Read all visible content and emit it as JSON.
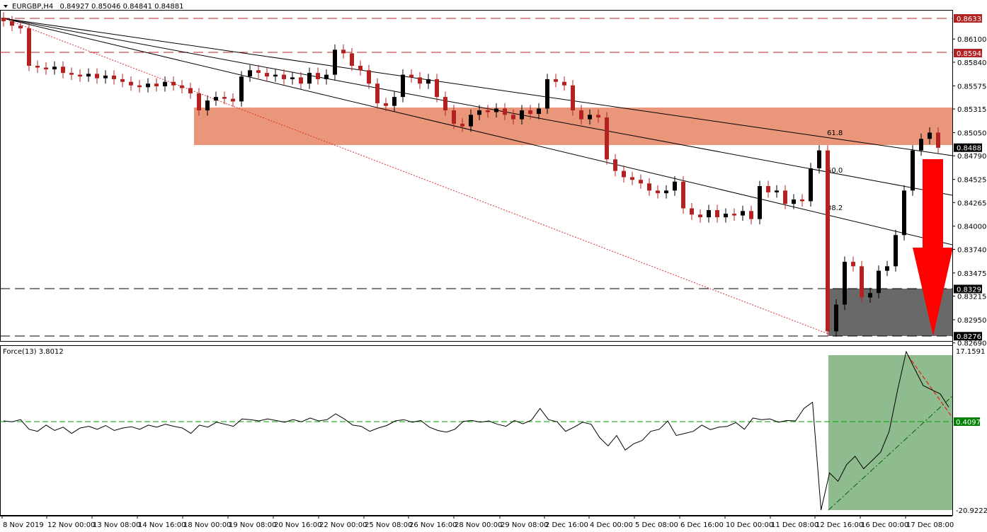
{
  "header": {
    "symbol": "EURGBP,H4",
    "open": "0.84927",
    "high": "0.85046",
    "low": "0.84841",
    "close": "0.84881"
  },
  "indicator": {
    "label": "Force(13) 3.8012",
    "max_label": "17.1591",
    "min_label": "-20.9222",
    "level_label": "0.4097"
  },
  "fib_labels": {
    "f618": "61.8",
    "f500": "50.0",
    "f382": "38.2"
  },
  "price_badges": [
    {
      "text": "0.86332",
      "price": 0.86332,
      "color": "#b22222"
    },
    {
      "text": "0.85943",
      "price": 0.85943,
      "color": "#b22222"
    },
    {
      "text": "0.84881",
      "price": 0.84881,
      "color": "#000000"
    },
    {
      "text": "0.83295",
      "price": 0.83295,
      "color": "#000000"
    },
    {
      "text": "0.82765",
      "price": 0.82765,
      "color": "#000000"
    }
  ],
  "price_ticks": [
    "0.86100",
    "0.85840",
    "0.85575",
    "0.85315",
    "0.85050",
    "0.84790",
    "0.84525",
    "0.84265",
    "0.84000",
    "0.83740",
    "0.83475",
    "0.83215",
    "0.82950",
    "0.82690"
  ],
  "time_labels": [
    "8 Nov 2019",
    "12 Nov 00:00",
    "13 Nov 08:00",
    "14 Nov 16:00",
    "18 Nov 00:00",
    "19 Nov 08:00",
    "20 Nov 16:00",
    "22 Nov 00:00",
    "25 Nov 08:00",
    "26 Nov 16:00",
    "28 Nov 00:00",
    "29 Nov 08:00",
    "2 Dec 16:00",
    "4 Dec 00:00",
    "5 Dec 08:00",
    "6 Dec 16:00",
    "10 Dec 00:00",
    "11 Dec 08:00",
    "12 Dec 16:00",
    "16 Dec 00:00",
    "17 Dec 08:00"
  ],
  "colors": {
    "bull": "#000000",
    "bear": "#b22222",
    "resistance_zone": "#e9967a",
    "support_zone": "#696969",
    "arrow": "#ff0000",
    "force_zone": "#8fbc8f"
  },
  "chart_data": {
    "type": "candlestick",
    "title": "EURGBP,H4",
    "ylim": [
      0.8269,
      0.864
    ],
    "closes": [
      0.863,
      0.8625,
      0.8622,
      0.858,
      0.8578,
      0.8576,
      0.8579,
      0.8572,
      0.857,
      0.8568,
      0.8571,
      0.8566,
      0.8569,
      0.8565,
      0.8562,
      0.8558,
      0.8556,
      0.856,
      0.8557,
      0.8562,
      0.8558,
      0.8555,
      0.8549,
      0.853,
      0.8541,
      0.8545,
      0.8543,
      0.854,
      0.8568,
      0.8575,
      0.8572,
      0.8568,
      0.857,
      0.8565,
      0.8567,
      0.856,
      0.8572,
      0.8565,
      0.857,
      0.8598,
      0.8594,
      0.858,
      0.8575,
      0.856,
      0.8538,
      0.8535,
      0.8545,
      0.857,
      0.8567,
      0.856,
      0.8565,
      0.8545,
      0.853,
      0.8515,
      0.8512,
      0.8525,
      0.853,
      0.8528,
      0.8532,
      0.8525,
      0.852,
      0.853,
      0.8526,
      0.8532,
      0.8565,
      0.8562,
      0.8558,
      0.853,
      0.852,
      0.8525,
      0.8522,
      0.8475,
      0.8462,
      0.8455,
      0.8452,
      0.8448,
      0.844,
      0.8437,
      0.844,
      0.845,
      0.842,
      0.8413,
      0.841,
      0.8418,
      0.841,
      0.8414,
      0.8412,
      0.8417,
      0.8408,
      0.8445,
      0.8438,
      0.844,
      0.8425,
      0.843,
      0.8428,
      0.8465,
      0.8485,
      0.8282,
      0.8312,
      0.836,
      0.8355,
      0.832,
      0.8325,
      0.835,
      0.8355,
      0.839,
      0.844,
      0.8485,
      0.8498,
      0.8505,
      0.8488
    ],
    "levels": [
      0.86332,
      0.85943,
      0.83295,
      0.82765
    ],
    "force": {
      "name": "Force(13)",
      "level": 0.4097,
      "ylim": [
        -20.9222,
        17.1591
      ],
      "values": [
        0.5,
        0.3,
        0.8,
        -1.5,
        -2.0,
        -0.5,
        -1.8,
        -1.0,
        -2.5,
        -1.2,
        -0.8,
        -1.5,
        -0.6,
        -1.8,
        -1.2,
        -0.9,
        -1.5,
        -0.5,
        -1.0,
        -0.3,
        -0.8,
        -1.2,
        -2.5,
        -0.5,
        -1.0,
        0.2,
        -0.3,
        -0.8,
        1.0,
        0.8,
        0.5,
        1.0,
        0.6,
        0.2,
        0.8,
        0.3,
        1.2,
        0.5,
        0.8,
        2.2,
        1.0,
        -0.5,
        -0.8,
        -2.0,
        -1.2,
        -0.6,
        0.5,
        0.8,
        0.2,
        0.6,
        -1.0,
        -1.8,
        -2.2,
        -1.5,
        0.4,
        0.6,
        0.2,
        0.5,
        -0.3,
        -0.8,
        0.6,
        -0.2,
        0.7,
        3.5,
        0.8,
        0.3,
        -2.0,
        -1.0,
        0.2,
        -0.3,
        -3.5,
        -5.5,
        -3.0,
        -6.5,
        -5.0,
        -4.2,
        -2.0,
        -1.5,
        0.5,
        -3.0,
        -2.5,
        -2.0,
        -0.5,
        -1.6,
        -1.0,
        -0.8,
        0.1,
        -1.5,
        1.2,
        0.8,
        1.0,
        0.2,
        0.6,
        0.5,
        3.5,
        5.0,
        -20.9,
        -12,
        -14,
        -10,
        -8,
        -11,
        -9,
        -7,
        -2,
        8,
        17.16,
        13,
        9,
        8,
        7,
        3.8
      ]
    }
  }
}
